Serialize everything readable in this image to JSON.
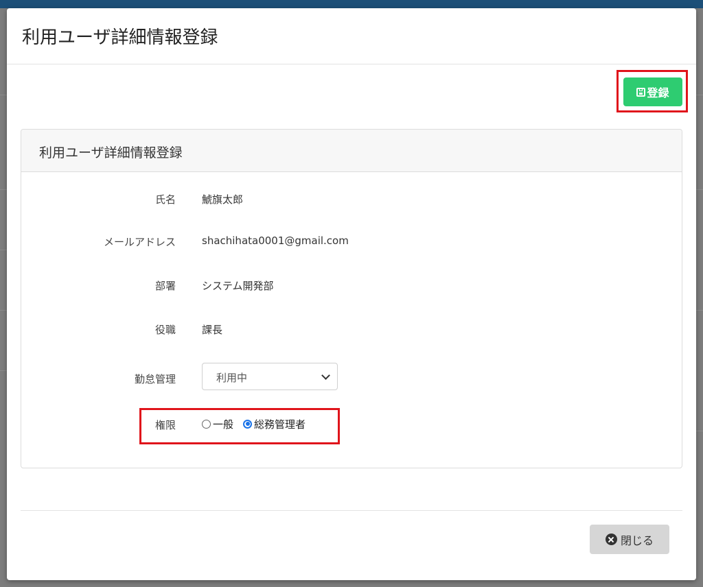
{
  "modal": {
    "title": "利用ユーザ詳細情報登録",
    "register_label": "登録",
    "close_label": "閉じる"
  },
  "card": {
    "title": "利用ユーザ詳細情報登録"
  },
  "fields": {
    "name": {
      "label": "氏名",
      "value": "鯱旗太郎"
    },
    "email": {
      "label": "メールアドレス",
      "value": "shachihata0001@gmail.com"
    },
    "department": {
      "label": "部署",
      "value": "システム開発部"
    },
    "position": {
      "label": "役職",
      "value": "課長"
    },
    "attendance": {
      "label": "勤怠管理",
      "selected": "利用中"
    },
    "permission": {
      "label": "権限",
      "options": [
        "一般",
        "総務管理者"
      ],
      "selected": "総務管理者"
    }
  },
  "colors": {
    "primary_button": "#2ecc71",
    "highlight_border": "#e0141b",
    "radio_checked": "#1a73e8"
  }
}
